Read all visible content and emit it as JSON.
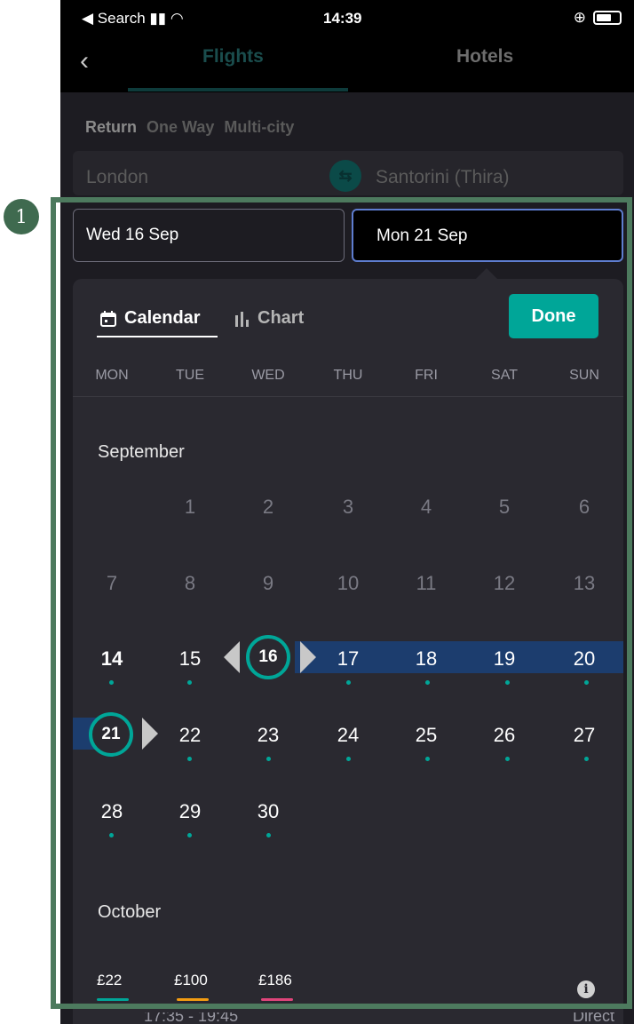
{
  "status_bar": {
    "back_label": "◀ Search",
    "time": "14:39"
  },
  "nav": {
    "tabs": [
      {
        "label": "Flights"
      },
      {
        "label": "Hotels"
      }
    ]
  },
  "trip_types": [
    "Return",
    "One Way",
    "Multi-city"
  ],
  "route": {
    "from": "London",
    "to": "Santorini (Thira)"
  },
  "dates": {
    "depart": "Wed 16 Sep",
    "return": "Mon 21 Sep"
  },
  "calendar": {
    "view_tabs": [
      "Calendar",
      "Chart"
    ],
    "done_label": "Done",
    "weekdays": [
      "MON",
      "TUE",
      "WED",
      "THU",
      "FRI",
      "SAT",
      "SUN"
    ],
    "months": [
      "September",
      "October"
    ],
    "days": {
      "d1": "1",
      "d2": "2",
      "d3": "3",
      "d4": "4",
      "d5": "5",
      "d6": "6",
      "d7": "7",
      "d8": "8",
      "d9": "9",
      "d10": "10",
      "d11": "11",
      "d12": "12",
      "d13": "13",
      "d14": "14",
      "d15": "15",
      "d16": "16",
      "d17": "17",
      "d18": "18",
      "d19": "19",
      "d20": "20",
      "d21": "21",
      "d22": "22",
      "d23": "23",
      "d24": "24",
      "d25": "25",
      "d26": "26",
      "d27": "27",
      "d28": "28",
      "d29": "29",
      "d30": "30"
    },
    "price_legend": [
      {
        "label": "£22",
        "color": "#00a698"
      },
      {
        "label": "£100",
        "color": "#f39c12"
      },
      {
        "label": "£186",
        "color": "#e0457b"
      }
    ],
    "accent_color": "#00a698",
    "range_color": "#1c3d6e"
  },
  "result_peek": {
    "times": "17:35 - 19:45",
    "stops": "Direct"
  },
  "annotation": {
    "marker": "1"
  }
}
